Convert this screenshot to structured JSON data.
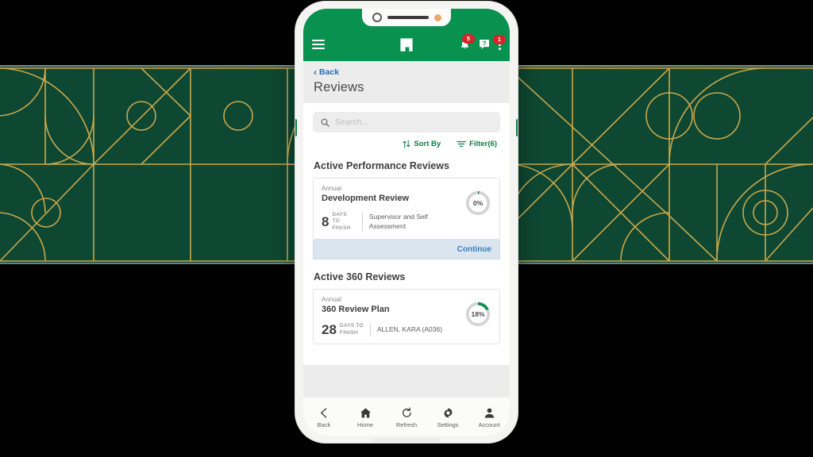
{
  "theme": {
    "header_green": "#099150",
    "band_green": "#0e4732",
    "band_gold": "#c9a84c",
    "accent_blue": "#3b7cc4",
    "badge_red": "#d8232a",
    "progress_green": "#0f9050"
  },
  "appbar": {
    "menu_icon": "hamburger-icon",
    "logo_icon": "paycom-logo-icon",
    "notifications": {
      "icon": "bell-icon",
      "badge": "5"
    },
    "help": {
      "icon": "help-question-icon"
    },
    "overflow": {
      "icon": "kebab-menu-icon",
      "badge": "1"
    }
  },
  "nav": {
    "back_chevron": "‹",
    "back_label": "Back"
  },
  "page": {
    "title": "Reviews"
  },
  "search": {
    "icon": "search-icon",
    "placeholder": "Search...",
    "value": ""
  },
  "tools": [
    {
      "icon": "sort-icon",
      "label": "Sort By"
    },
    {
      "icon": "filter-icon",
      "label": "Filter(6)"
    }
  ],
  "sections": [
    {
      "title": "Active Performance Reviews",
      "card": {
        "kicker": "Annual",
        "title": "Development Review",
        "days_number": "8",
        "days_label_line1": "DAYS TO",
        "days_label_line2": "FINISH",
        "meta": "Supervisor and Self Assessment",
        "progress_percent": 0,
        "progress_text": "0%",
        "action_label": "Continue"
      }
    },
    {
      "title": "Active 360 Reviews",
      "card": {
        "kicker": "Annual",
        "title": "360 Review Plan",
        "days_number": "28",
        "days_label_line1": "DAYS TO",
        "days_label_line2": "FINISH",
        "meta": "ALLEN, KARA (A036)",
        "progress_percent": 18,
        "progress_text": "18%",
        "action_label": ""
      }
    }
  ],
  "bottom_nav": [
    {
      "icon": "chevron-left-icon",
      "label": "Back"
    },
    {
      "icon": "home-icon",
      "label": "Home"
    },
    {
      "icon": "refresh-icon",
      "label": "Refresh"
    },
    {
      "icon": "gear-icon",
      "label": "Settings"
    },
    {
      "icon": "person-icon",
      "label": "Account"
    }
  ]
}
